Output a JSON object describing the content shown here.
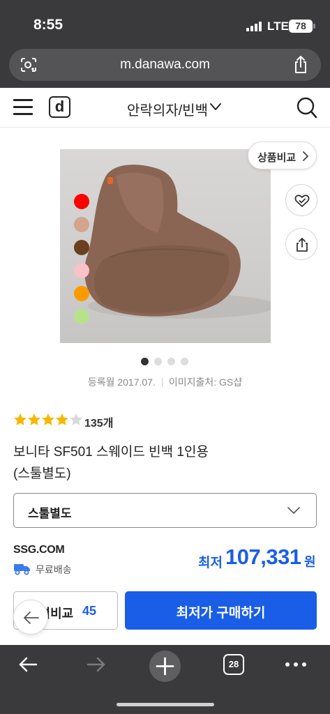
{
  "status_bar": {
    "time": "8:55",
    "network": "LTE",
    "battery": "78"
  },
  "browser": {
    "url": "m.danawa.com",
    "tab_count": "28"
  },
  "header": {
    "logo": "d",
    "category": "안락의자/빈백"
  },
  "product": {
    "compare_label": "상품비교",
    "color_swatches": [
      "#ff0000",
      "#d4a48e",
      "#6b3f1f",
      "#f7c3c8",
      "#ff9900",
      "#b7e28a"
    ],
    "image_count": 4,
    "active_image_index": 0,
    "registered": "등록월 2017.07.",
    "image_source": "이미지출처: GS샵",
    "rating": 4.5,
    "review_count": "135개",
    "title_line1": "보니타 SF501 스웨이드 빈백 1인용",
    "title_line2": "(스툴별도)",
    "option_value": "스툴별도"
  },
  "offer": {
    "seller": "SSG.COM",
    "shipping": "무료배송",
    "price_label": "최저",
    "price": "107,331",
    "price_unit": "원",
    "compare_label": "가격비교",
    "compare_count": "45",
    "buy_label": "최저가 구매하기"
  },
  "colors": {
    "accent": "#1a5ee8",
    "chrome": "#3a3a3c",
    "star": "#f5b800"
  }
}
